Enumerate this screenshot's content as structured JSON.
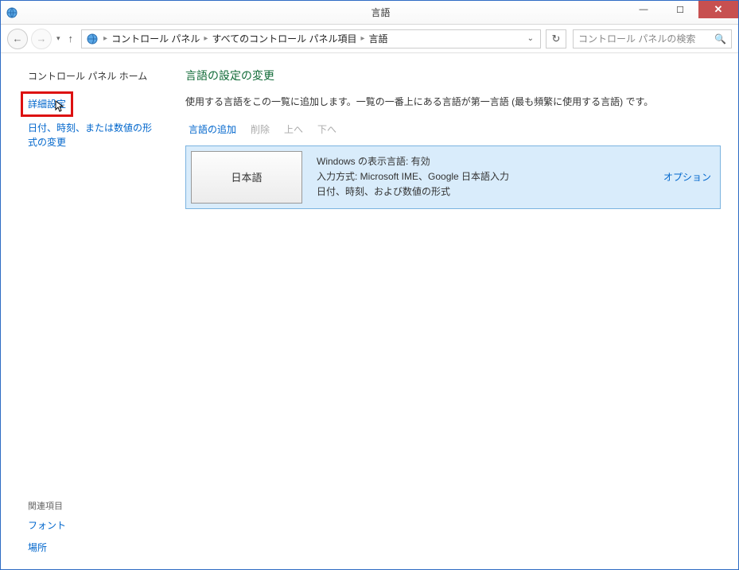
{
  "window": {
    "title": "言語"
  },
  "nav": {
    "breadcrumb": [
      "コントロール パネル",
      "すべてのコントロール パネル項目",
      "言語"
    ],
    "search_placeholder": "コントロール パネルの検索"
  },
  "sidebar": {
    "home": "コントロール パネル ホーム",
    "links": [
      {
        "label": "詳細設定",
        "highlighted": true
      },
      {
        "label": "日付、時刻、または数値の形式の変更",
        "highlighted": false
      }
    ],
    "related_title": "関連項目",
    "related_links": [
      "フォント",
      "場所"
    ]
  },
  "main": {
    "heading": "言語の設定の変更",
    "description": "使用する言語をこの一覧に追加します。一覧の一番上にある言語が第一言語 (最も頻繁に使用する言語) です。",
    "toolbar": {
      "add": "言語の追加",
      "remove": "削除",
      "up": "上へ",
      "down": "下へ"
    },
    "languages": [
      {
        "name": "日本語",
        "detail_display": "Windows の表示言語: 有効",
        "detail_input": "入力方式: Microsoft IME、Google 日本語入力",
        "detail_format": "日付、時刻、および数値の形式",
        "options_label": "オプション"
      }
    ]
  }
}
